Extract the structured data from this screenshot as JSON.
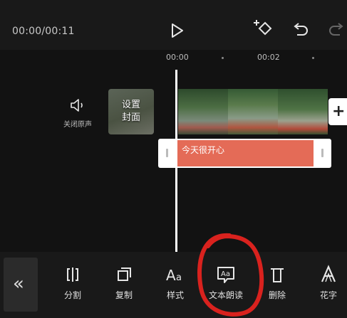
{
  "player": {
    "time": "00:00/00:11"
  },
  "ruler": {
    "marks": [
      "00:00",
      "00:02"
    ]
  },
  "track": {
    "mute_label": "关闭原声",
    "cover_label_line1": "设置",
    "cover_label_line2": "封面",
    "text_clip": "今天很开心"
  },
  "toolbar": {
    "items": [
      {
        "label": "分割",
        "icon": "split-icon"
      },
      {
        "label": "复制",
        "icon": "copy-icon"
      },
      {
        "label": "样式",
        "icon": "text-style-icon"
      },
      {
        "label": "文本朗读",
        "icon": "text-to-speech-icon"
      },
      {
        "label": "删除",
        "icon": "delete-icon"
      },
      {
        "label": "花字",
        "icon": "fancy-text-icon"
      }
    ]
  },
  "annotation": {
    "color": "#d9221e"
  },
  "colors": {
    "text_clip": "#e46b57",
    "background": "#121212"
  }
}
